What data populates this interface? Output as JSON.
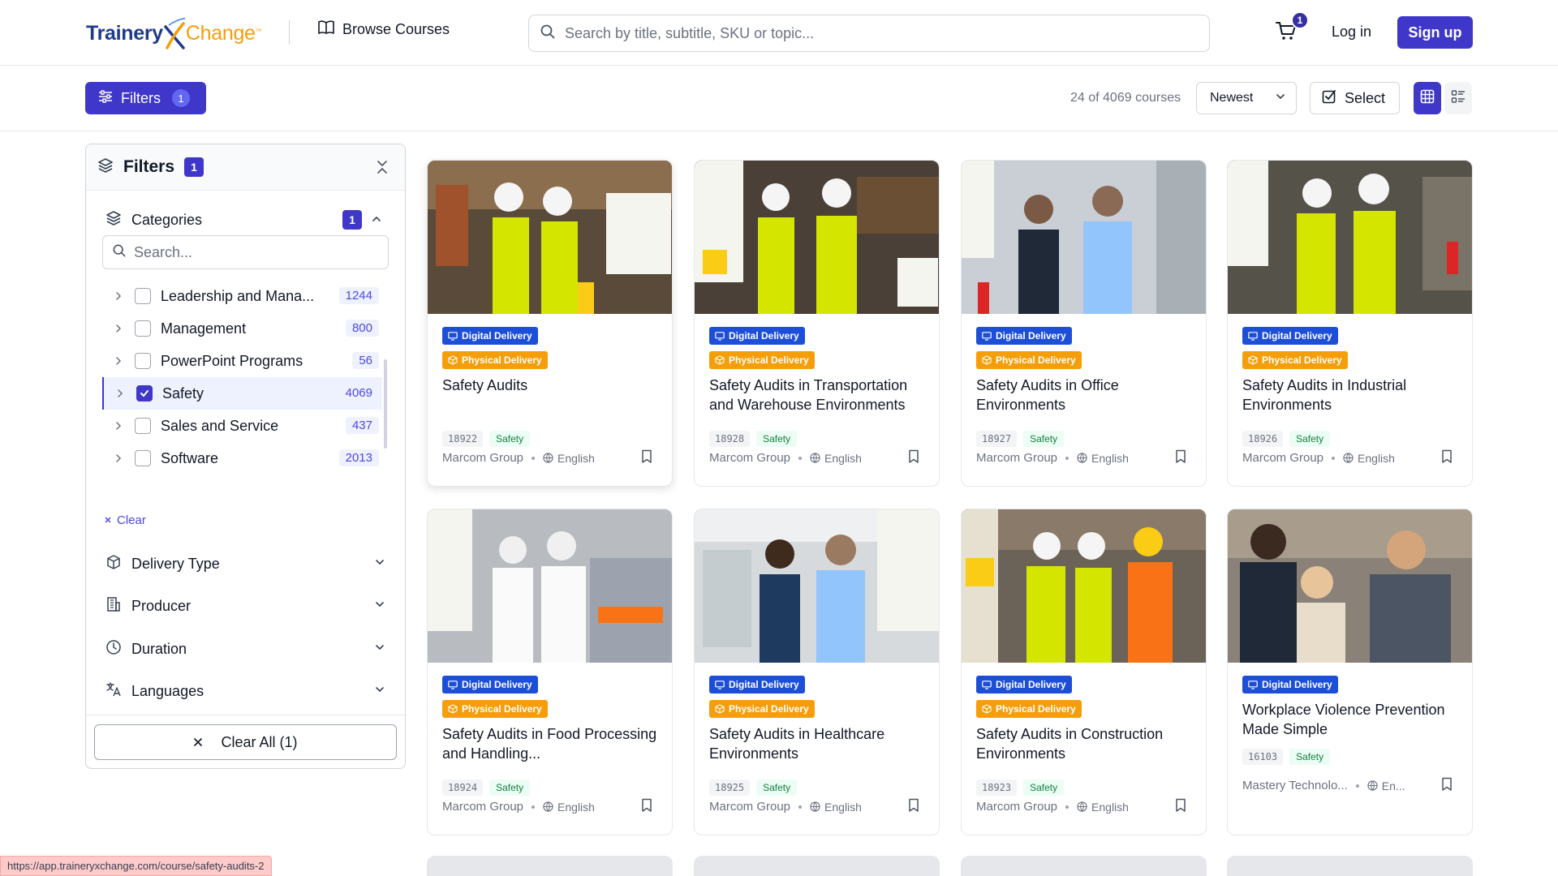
{
  "brand": {
    "part1": "Trainery",
    "part2": "Change",
    "tm": "™"
  },
  "header": {
    "browse_label": "Browse Courses",
    "search_placeholder": "Search by title, subtitle, SKU or topic...",
    "cart_count": "1",
    "login_label": "Log in",
    "signup_label": "Sign up"
  },
  "toolbar": {
    "filters_label": "Filters",
    "filters_count": "1",
    "result_count": "24 of 4069 courses",
    "sort_value": "Newest",
    "select_label": "Select"
  },
  "sidebar": {
    "title": "Filters",
    "badge": "1",
    "categories_label": "Categories",
    "categories_badge": "1",
    "search_placeholder": "Search...",
    "items": [
      {
        "name": "Leadership and Mana...",
        "count": "1244",
        "checked": false
      },
      {
        "name": "Management",
        "count": "800",
        "checked": false
      },
      {
        "name": "PowerPoint Programs",
        "count": "56",
        "checked": false
      },
      {
        "name": "Safety",
        "count": "4069",
        "checked": true
      },
      {
        "name": "Sales and Service",
        "count": "437",
        "checked": false
      },
      {
        "name": "Software",
        "count": "2013",
        "checked": false
      }
    ],
    "clear_label": "Clear",
    "delivery_type_label": "Delivery Type",
    "producer_label": "Producer",
    "duration_label": "Duration",
    "languages_label": "Languages",
    "clear_all_label": "Clear All (1)"
  },
  "tags": {
    "digital": "Digital Delivery",
    "physical": "Physical Delivery"
  },
  "courses": [
    {
      "title": "Safety Audits",
      "sku": "18922",
      "category": "Safety",
      "producer": "Marcom Group",
      "language": "English"
    },
    {
      "title": "Safety Audits in Transportation and Warehouse Environments",
      "sku": "18928",
      "category": "Safety",
      "producer": "Marcom Group",
      "language": "English"
    },
    {
      "title": "Safety Audits in Office Environments",
      "sku": "18927",
      "category": "Safety",
      "producer": "Marcom Group",
      "language": "English"
    },
    {
      "title": "Safety Audits in Industrial Environments",
      "sku": "18926",
      "category": "Safety",
      "producer": "Marcom Group",
      "language": "English"
    },
    {
      "title": "Safety Audits in Food Processing and Handling...",
      "sku": "18924",
      "category": "Safety",
      "producer": "Marcom Group",
      "language": "English"
    },
    {
      "title": "Safety Audits in Healthcare Environments",
      "sku": "18925",
      "category": "Safety",
      "producer": "Marcom Group",
      "language": "English"
    },
    {
      "title": "Safety Audits in Construction Environments",
      "sku": "18923",
      "category": "Safety",
      "producer": "Marcom Group",
      "language": "English"
    },
    {
      "title": "Workplace Violence Prevention Made Simple",
      "sku": "16103",
      "category": "Safety",
      "producer": "Mastery Technolo...",
      "language": "En..."
    }
  ],
  "status_url": "https://app.traineryxchange.com/course/safety-audits-2",
  "colors": {
    "primary": "#3f37c9",
    "digital": "#1d4ed8",
    "physical": "#f59e0b",
    "safety_green": "#15803d"
  }
}
